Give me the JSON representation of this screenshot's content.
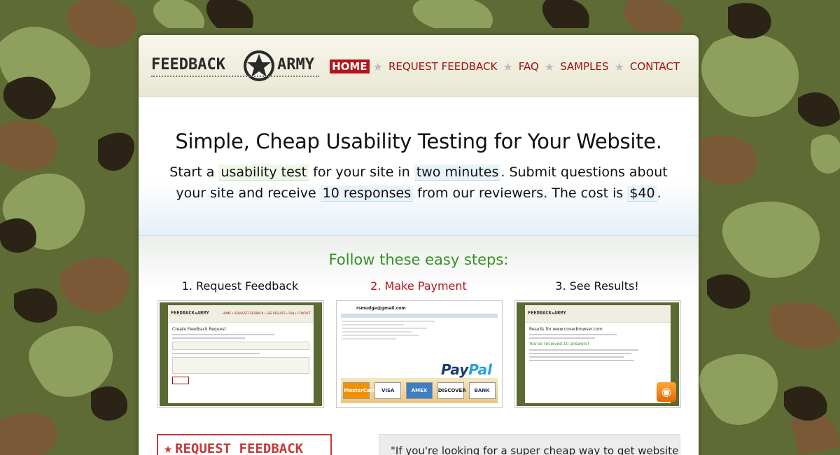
{
  "colors": {
    "brand_red": "#b3151b",
    "nav_text": "#a01010",
    "steps_green": "#3a8e25",
    "camo_dark": "#2b2416",
    "camo_olive": "#5e6b34",
    "camo_light": "#8fa05e"
  },
  "logo": {
    "word1": "FEEDBACK",
    "word2": "ARMY",
    "icon": "star-badge-icon"
  },
  "nav": {
    "items": [
      {
        "label": "HOME",
        "active": true
      },
      {
        "label": "REQUEST FEEDBACK",
        "active": false
      },
      {
        "label": "FAQ",
        "active": false
      },
      {
        "label": "SAMPLES",
        "active": false
      },
      {
        "label": "CONTACT",
        "active": false
      }
    ],
    "separator_icon": "star-separator-icon"
  },
  "hero": {
    "title": "Simple, Cheap Usability Testing for Your Website.",
    "t1": "Start a",
    "h1": "usability test",
    "t2": "for your site in",
    "h2": "two minutes",
    "t3": ". Submit questions about your site and receive",
    "h3": "10 responses",
    "t4": "from our reviewers. The cost is",
    "h4": "$40",
    "t5": "."
  },
  "steps": {
    "title": "Follow these easy steps:",
    "items": [
      {
        "label": "1. Request Feedback"
      },
      {
        "label": "2. Make Payment"
      },
      {
        "label": "3. See Results!"
      }
    ]
  },
  "thumb1": {
    "logo": "FEEDBACK★ARMY",
    "nav": "HOME • REQUEST FEEDBACK • SEE RESULTS • FAQ • CONTACT",
    "heading": "Create Feedback Request"
  },
  "thumb2": {
    "email": "rsmudge@gmail.com",
    "brand_a": "Pay",
    "brand_b": "Pal",
    "cards": [
      "MasterCard",
      "VISA",
      "AMEX",
      "DISCOVER",
      "BANK"
    ]
  },
  "thumb3": {
    "logo": "FEEDBACK★ARMY",
    "heading": "Results for www.coverbrowser.com",
    "received": "You've received 10 answers!"
  },
  "bottom": {
    "stamp": "REQUEST FEEDBACK",
    "quote": "\"If you're looking for a super cheap way to get website feedback"
  }
}
